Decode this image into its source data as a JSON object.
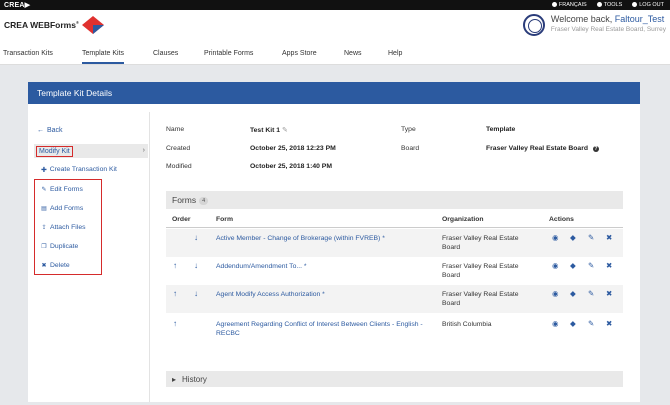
{
  "topbar": {
    "brand": "CREA▶",
    "links": [
      {
        "label": "FRANÇAIS",
        "icon": "globe-icon"
      },
      {
        "label": "TOOLS",
        "icon": "gear-icon"
      },
      {
        "label": "LOG OUT",
        "icon": "power-icon"
      }
    ]
  },
  "header": {
    "logo_text": "CREA WEBForms",
    "logo_reg": "®",
    "welcome_prefix": "Welcome back,",
    "username": "Faltour_Test",
    "board": "Fraser Valley Real Estate Board, Surrey"
  },
  "nav": {
    "items": [
      "Transaction Kits",
      "Template Kits",
      "Clauses",
      "Printable Forms",
      "Apps Store",
      "News",
      "Help"
    ],
    "active": "Template Kits"
  },
  "panel": {
    "title": "Template Kit Details"
  },
  "menu": {
    "back": "Back",
    "current": "Modify Kit",
    "create": "Create Transaction Kit",
    "items": [
      {
        "label": "Edit Forms",
        "icon": "pencil-icon"
      },
      {
        "label": "Add Forms",
        "icon": "document-icon"
      },
      {
        "label": "Attach Files",
        "icon": "upload-icon"
      },
      {
        "label": "Duplicate",
        "icon": "copy-icon"
      },
      {
        "label": "Delete",
        "icon": "close-icon"
      }
    ]
  },
  "details": {
    "name_label": "Name",
    "name_value": "Test Kit 1",
    "created_label": "Created",
    "created_value": "October 25, 2018 12:23 PM",
    "modified_label": "Modified",
    "modified_value": "October 25, 2018 1:40 PM",
    "type_label": "Type",
    "type_value": "Template",
    "board_label": "Board",
    "board_value": "Fraser Valley Real Estate Board"
  },
  "forms": {
    "title": "Forms",
    "count": "4",
    "columns": {
      "order": "Order",
      "form": "Form",
      "organization": "Organization",
      "actions": "Actions"
    },
    "rows": [
      {
        "name": "Active Member - Change of Brokerage (within FVREB) *",
        "org": "Fraser Valley Real Estate Board",
        "up": false,
        "down": true
      },
      {
        "name": "Addendum/Amendment To... *",
        "org": "Fraser Valley Real Estate Board",
        "up": true,
        "down": true
      },
      {
        "name": "Agent Modify Access Authorization *",
        "org": "Fraser Valley Real Estate Board",
        "up": true,
        "down": true
      },
      {
        "name": "Agreement Regarding Conflict of Interest Between Clients - English - RECBC",
        "org": "British Columbia",
        "up": true,
        "down": false
      }
    ]
  },
  "history": {
    "title": "History"
  },
  "colors": {
    "brand_blue": "#2c5aa0",
    "highlight_red": "#d52b2b",
    "logo_red": "#e0312f"
  }
}
